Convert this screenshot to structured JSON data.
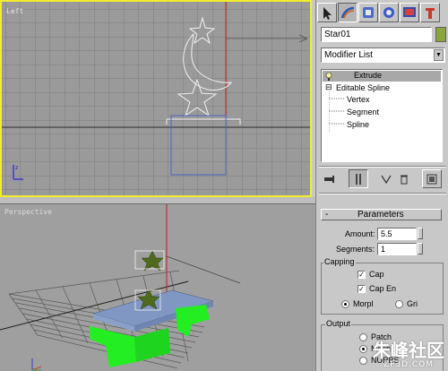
{
  "viewports": {
    "top_label": "Left",
    "bottom_label": "Perspective"
  },
  "panel": {
    "tabs": [
      "create-tab-icon",
      "modify-tab-icon",
      "hierarchy-tab-icon",
      "motion-tab-icon",
      "display-tab-icon",
      "utilities-tab-icon"
    ],
    "object_name": "Star01",
    "object_color": "#8aa63a",
    "modifier_list": "Modifier List",
    "stack": [
      {
        "label": "Extrude",
        "selected": true
      },
      {
        "label": "Editable Spline",
        "selected": false
      },
      {
        "label": "Vertex",
        "selected": false
      },
      {
        "label": "Segment",
        "selected": false
      },
      {
        "label": "Spline",
        "selected": false
      }
    ],
    "stack_expander": "⊟",
    "rollout_sign": "-",
    "rollout_title": "Parameters",
    "amount_label": "Amount:",
    "amount_value": "5.5",
    "segments_label": "Segments:",
    "segments_value": "1",
    "capping_label": "Capping",
    "cap_start": "Cap",
    "cap_end": "Cap En",
    "morph": "Morpl",
    "grid": "Gri",
    "output_label": "Output",
    "output_items": [
      "Patch",
      "Mesh",
      "NURBS"
    ]
  },
  "watermark": {
    "main": "朱峰社区",
    "sub": "ZF3D.COM"
  },
  "colors": {
    "viewport_active_border": "#f2ee2c",
    "shape_white": "#f2f2f2",
    "box_blue": "#4a66c8",
    "table_top": "#7f97c2",
    "table_legs": "#22ee22",
    "star_green": "#4f6a1c"
  }
}
